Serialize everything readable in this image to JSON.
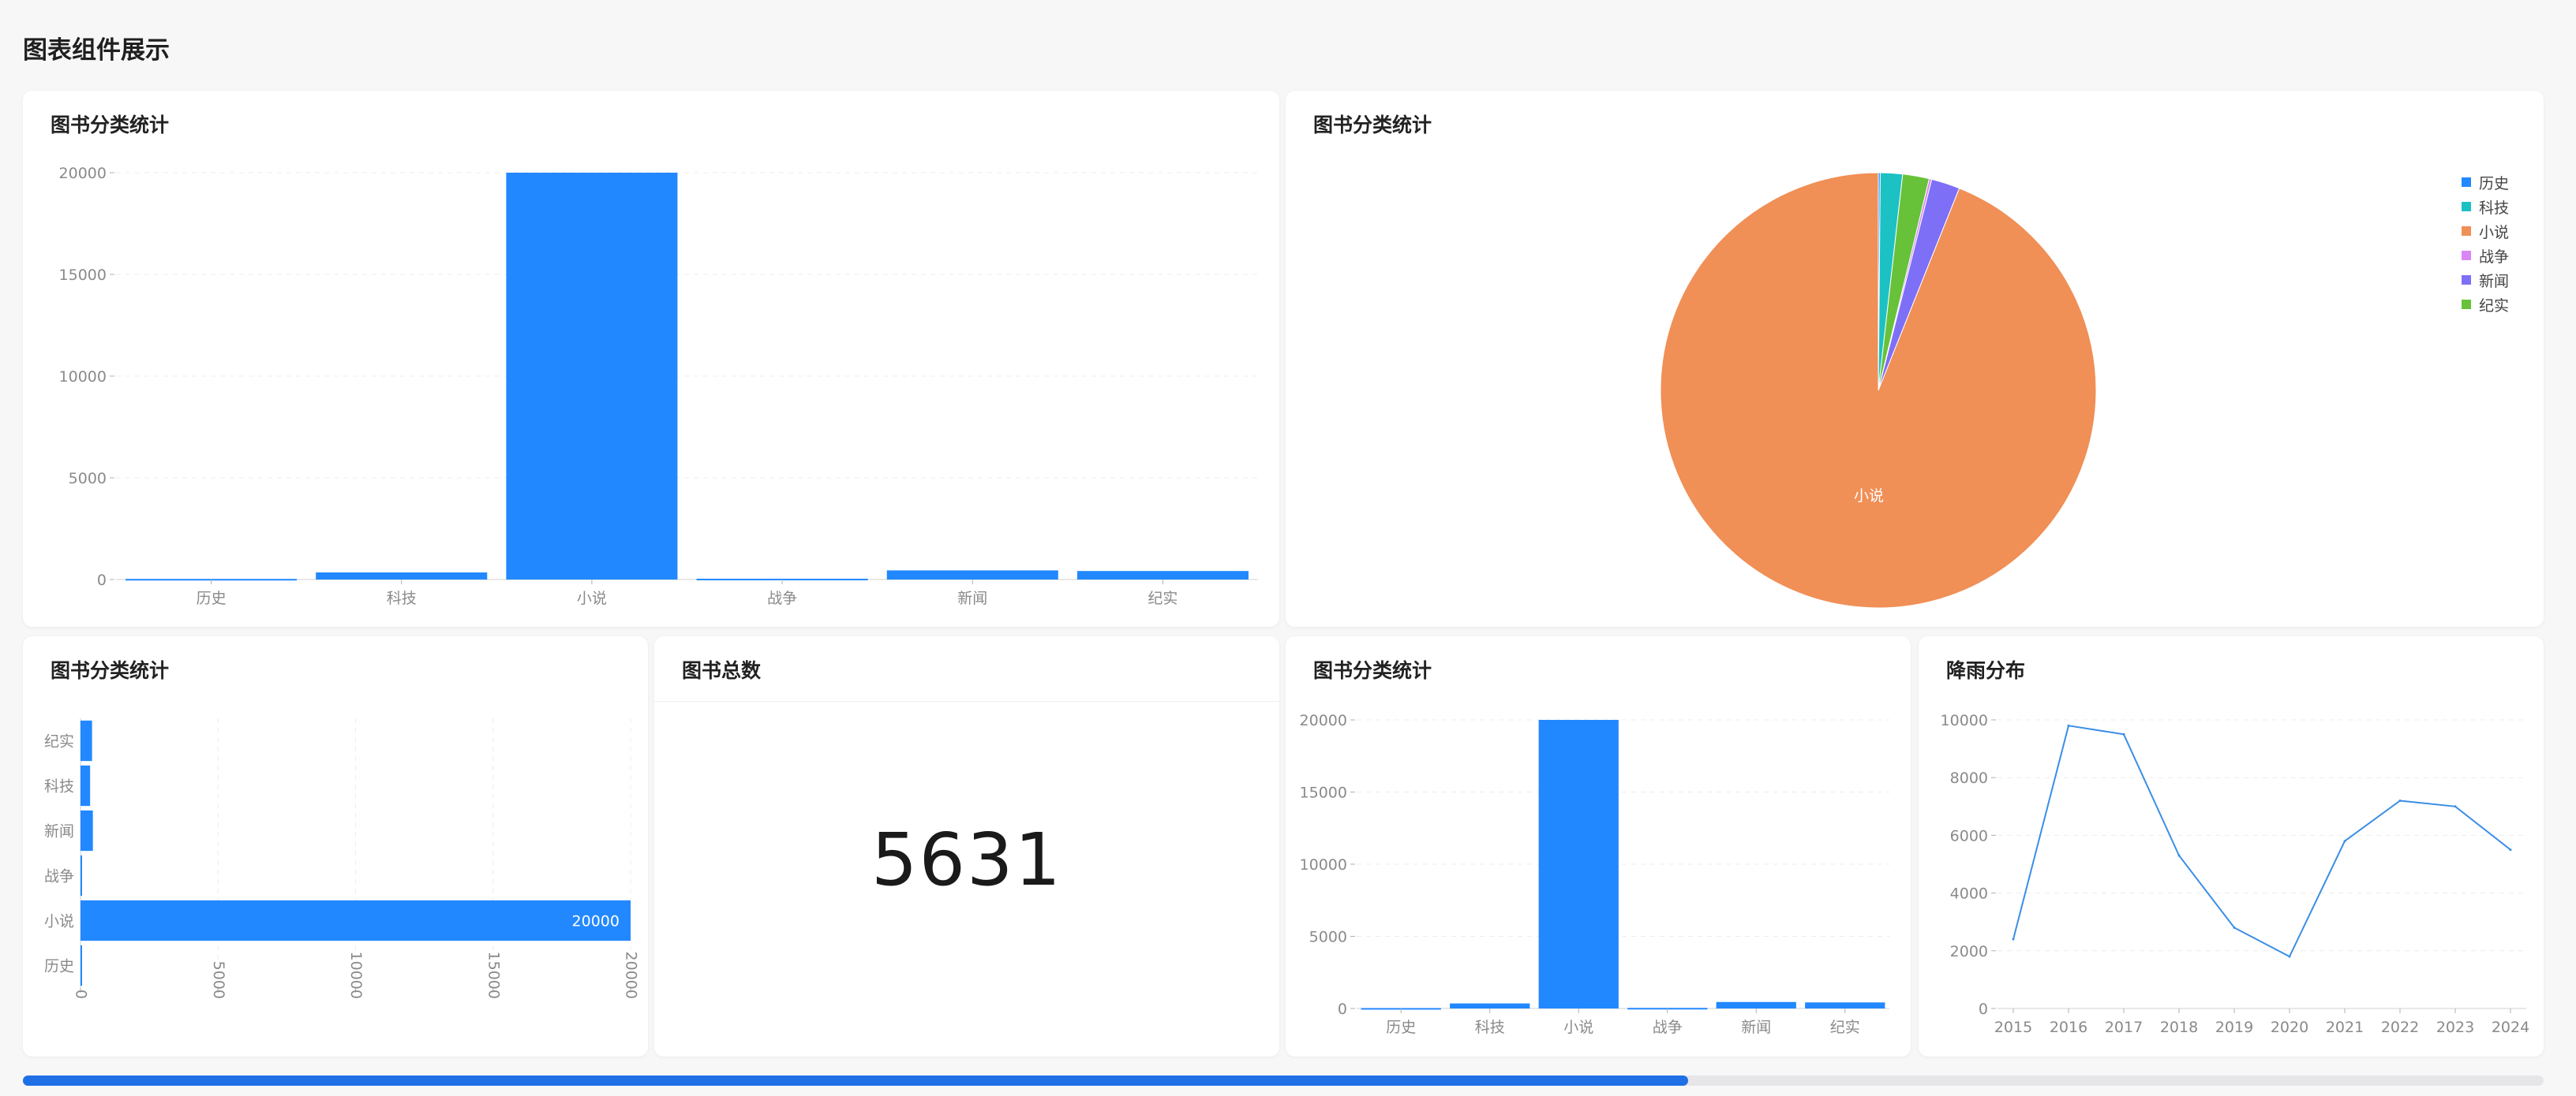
{
  "page": {
    "title": "图表组件展示"
  },
  "cards": {
    "bar_top": {
      "title": "图书分类统计"
    },
    "pie": {
      "title": "图书分类统计"
    },
    "hbar": {
      "title": "图书分类统计"
    },
    "total": {
      "title": "图书总数",
      "value": "5631"
    },
    "bar_small": {
      "title": "图书分类统计"
    },
    "line": {
      "title": "降雨分布"
    }
  },
  "colors": {
    "bar": "#2288ff",
    "line": "#3a8ee6",
    "pie": [
      "#2288ff",
      "#1cc1c4",
      "#f08f56",
      "#d987f5",
      "#7e6ff7",
      "#67c23a"
    ],
    "scrollbar": "#1f6fe6"
  },
  "chart_data": [
    {
      "id": "bar_top",
      "type": "bar",
      "title": "图书分类统计",
      "categories": [
        "历史",
        "科技",
        "小说",
        "战争",
        "新闻",
        "纪实"
      ],
      "values": [
        30,
        350,
        20000,
        40,
        450,
        420
      ],
      "yticks": [
        "0",
        "5000",
        "10000",
        "15000",
        "20000"
      ],
      "ylim": [
        0,
        20000
      ],
      "grid": true
    },
    {
      "id": "pie",
      "type": "pie",
      "title": "图书分类统计",
      "categories": [
        "历史",
        "科技",
        "小说",
        "战争",
        "新闻",
        "纪实"
      ],
      "values": [
        30,
        350,
        20000,
        40,
        450,
        420
      ],
      "slice_label": "小说",
      "legend": "right-top"
    },
    {
      "id": "hbar",
      "type": "bar",
      "orientation": "horizontal",
      "title": "图书分类统计",
      "categories": [
        "历史",
        "小说",
        "战争",
        "新闻",
        "科技",
        "纪实"
      ],
      "values": [
        30,
        20000,
        40,
        450,
        350,
        420
      ],
      "value_label": "20000",
      "xticks": [
        "0",
        "5000",
        "10000",
        "15000",
        "20000"
      ],
      "xlim": [
        0,
        20000
      ],
      "grid": true
    },
    {
      "id": "bar_small",
      "type": "bar",
      "title": "图书分类统计",
      "categories": [
        "历史",
        "科技",
        "小说",
        "战争",
        "新闻",
        "纪实"
      ],
      "values": [
        30,
        350,
        20000,
        40,
        450,
        420
      ],
      "yticks": [
        "0",
        "5000",
        "10000",
        "15000",
        "20000"
      ],
      "ylim": [
        0,
        20000
      ],
      "grid": true
    },
    {
      "id": "line",
      "type": "line",
      "title": "降雨分布",
      "x": [
        "2015",
        "2016",
        "2017",
        "2018",
        "2019",
        "2020",
        "2021",
        "2022",
        "2023",
        "2024"
      ],
      "y": [
        2400,
        9800,
        9500,
        5300,
        2800,
        1800,
        5800,
        7200,
        7000,
        5500
      ],
      "yticks": [
        "0",
        "2000",
        "4000",
        "6000",
        "8000",
        "10000"
      ],
      "ylim": [
        0,
        10000
      ],
      "grid": true
    }
  ]
}
